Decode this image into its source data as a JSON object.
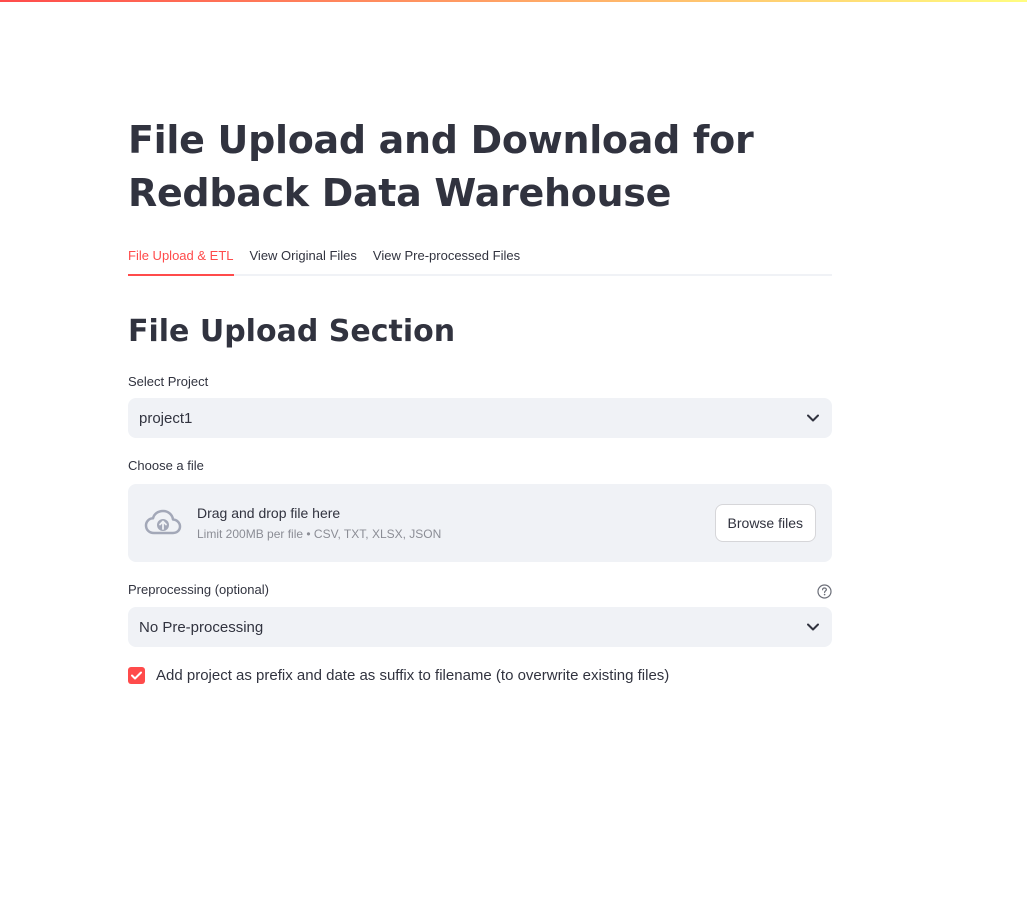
{
  "app": {
    "title": "File Upload and Download for Redback Data Warehouse",
    "accent_color": "#ff4b4b"
  },
  "tabs": [
    {
      "label": "File Upload & ETL",
      "active": true
    },
    {
      "label": "View Original Files",
      "active": false
    },
    {
      "label": "View Pre-processed Files",
      "active": false
    }
  ],
  "section": {
    "title": "File Upload Section"
  },
  "project_select": {
    "label": "Select Project",
    "value": "project1",
    "icon": "chevron-down-icon"
  },
  "file_uploader": {
    "label": "Choose a file",
    "title": "Drag and drop file here",
    "hint": "Limit 200MB per file • CSV, TXT, XLSX, JSON",
    "button_label": "Browse files",
    "icon": "cloud-upload-icon"
  },
  "preprocessing_select": {
    "label": "Preprocessing (optional)",
    "value": "No Pre-processing",
    "help_icon": "question-circle-icon",
    "icon": "chevron-down-icon"
  },
  "rename_checkbox": {
    "label": "Add project as prefix and date as suffix to filename (to overwrite existing files)",
    "checked": true
  }
}
